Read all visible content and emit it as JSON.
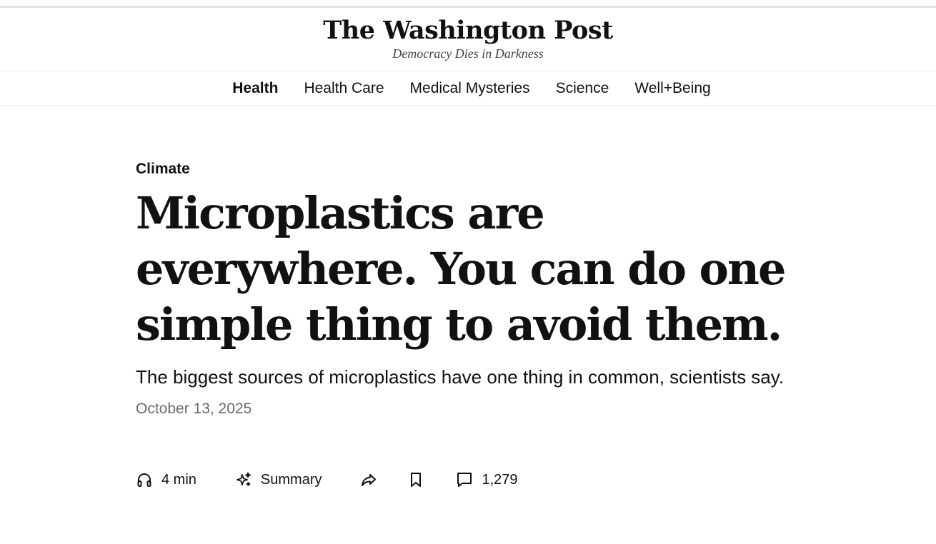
{
  "masthead": {
    "logo": "The Washington Post",
    "tagline": "Democracy Dies in Darkness"
  },
  "section_nav": {
    "items": [
      {
        "label": "Health",
        "active": true
      },
      {
        "label": "Health Care",
        "active": false
      },
      {
        "label": "Medical Mysteries",
        "active": false
      },
      {
        "label": "Science",
        "active": false
      },
      {
        "label": "Well+Being",
        "active": false
      }
    ]
  },
  "article": {
    "kicker": "Climate",
    "headline": "Microplastics are everywhere. You can do one simple thing to avoid them.",
    "dek": "The biggest sources of microplastics have one thing in common, scientists say.",
    "date": "October 13, 2025"
  },
  "actions": {
    "listen": {
      "icon": "headphones-icon",
      "label": "4 min"
    },
    "summary": {
      "icon": "sparkle-icon",
      "label": "Summary"
    },
    "share": {
      "icon": "share-icon"
    },
    "save": {
      "icon": "bookmark-icon"
    },
    "comments": {
      "icon": "comment-icon",
      "label": "1,279"
    }
  },
  "colors": {
    "text": "#111111",
    "muted": "#6b6b6b",
    "divider": "#e2e2e2"
  }
}
